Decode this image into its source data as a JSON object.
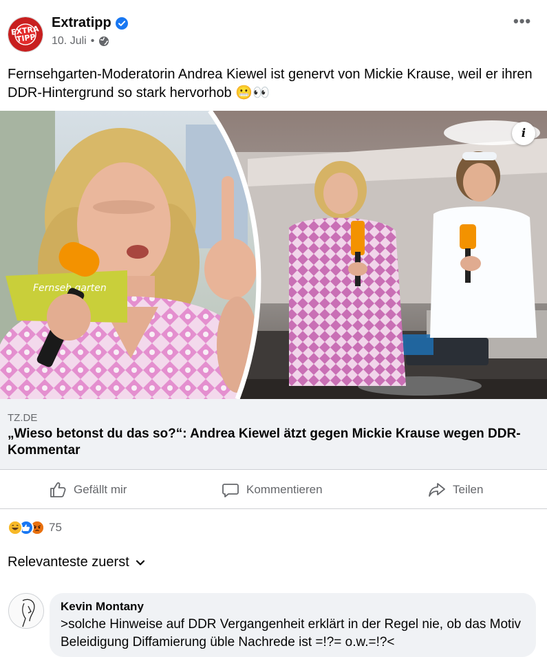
{
  "post": {
    "author": "Extratipp",
    "avatar_text": "EXTRA TIPP",
    "date": "10. Juli",
    "separator": "•",
    "privacy_icon": "globe-icon",
    "more_icon": "ellipsis-icon",
    "text": "Fernsehgarten-Moderatorin Andrea Kiewel ist genervt von Mickie Krause, weil er ihren DDR-Hintergrund so stark hervorhob 😬👀"
  },
  "link": {
    "domain": "TZ.DE",
    "title": "„Wieso betonst du das so?“: Andrea Kiewel ätzt gegen Mickie Krause wegen DDR-Kommentar",
    "info_label": "i",
    "card_lettering": "Fernseh garten"
  },
  "actions": {
    "like": "Gefällt mir",
    "comment": "Kommentieren",
    "share": "Teilen"
  },
  "reactions": {
    "items": [
      "haha",
      "like",
      "angry"
    ],
    "count": "75"
  },
  "sort": {
    "label": "Relevanteste zuerst"
  },
  "comment": {
    "author": "Kevin Montany",
    "text": ">solche Hinweise auf DDR Vergangenheit erklärt  in der Regel nie, ob das Motiv Beleidigung Diffamierung üble Nachrede ist =!?= o.w.=!?<"
  },
  "colors": {
    "verified": "#1877f2",
    "secondary_text": "#65676b",
    "link_bg": "#f0f2f5",
    "pink_dress": "#e59bd0",
    "zdf_orange": "#f39200"
  }
}
